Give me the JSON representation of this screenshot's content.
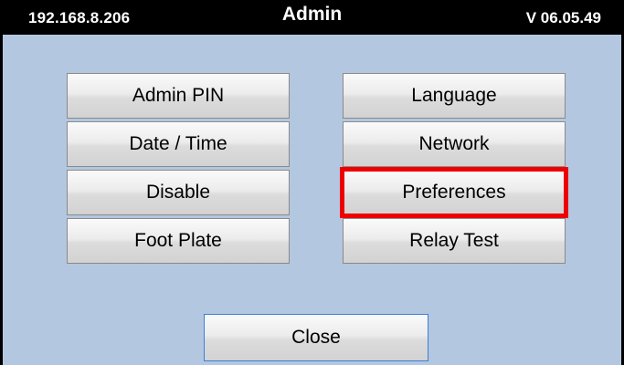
{
  "header": {
    "ip_address": "192.168.8.206",
    "title": "Admin",
    "version": "V 06.05.49"
  },
  "menu": {
    "admin_pin": "Admin PIN",
    "date_time": "Date / Time",
    "disable": "Disable",
    "foot_plate": "Foot Plate",
    "language": "Language",
    "network": "Network",
    "preferences": "Preferences",
    "relay_test": "Relay Test"
  },
  "footer": {
    "close": "Close"
  },
  "colors": {
    "background": "#b3c7e0",
    "titlebar": "#000000",
    "highlight": "#ee0000",
    "close_border": "#3d7fd9"
  }
}
